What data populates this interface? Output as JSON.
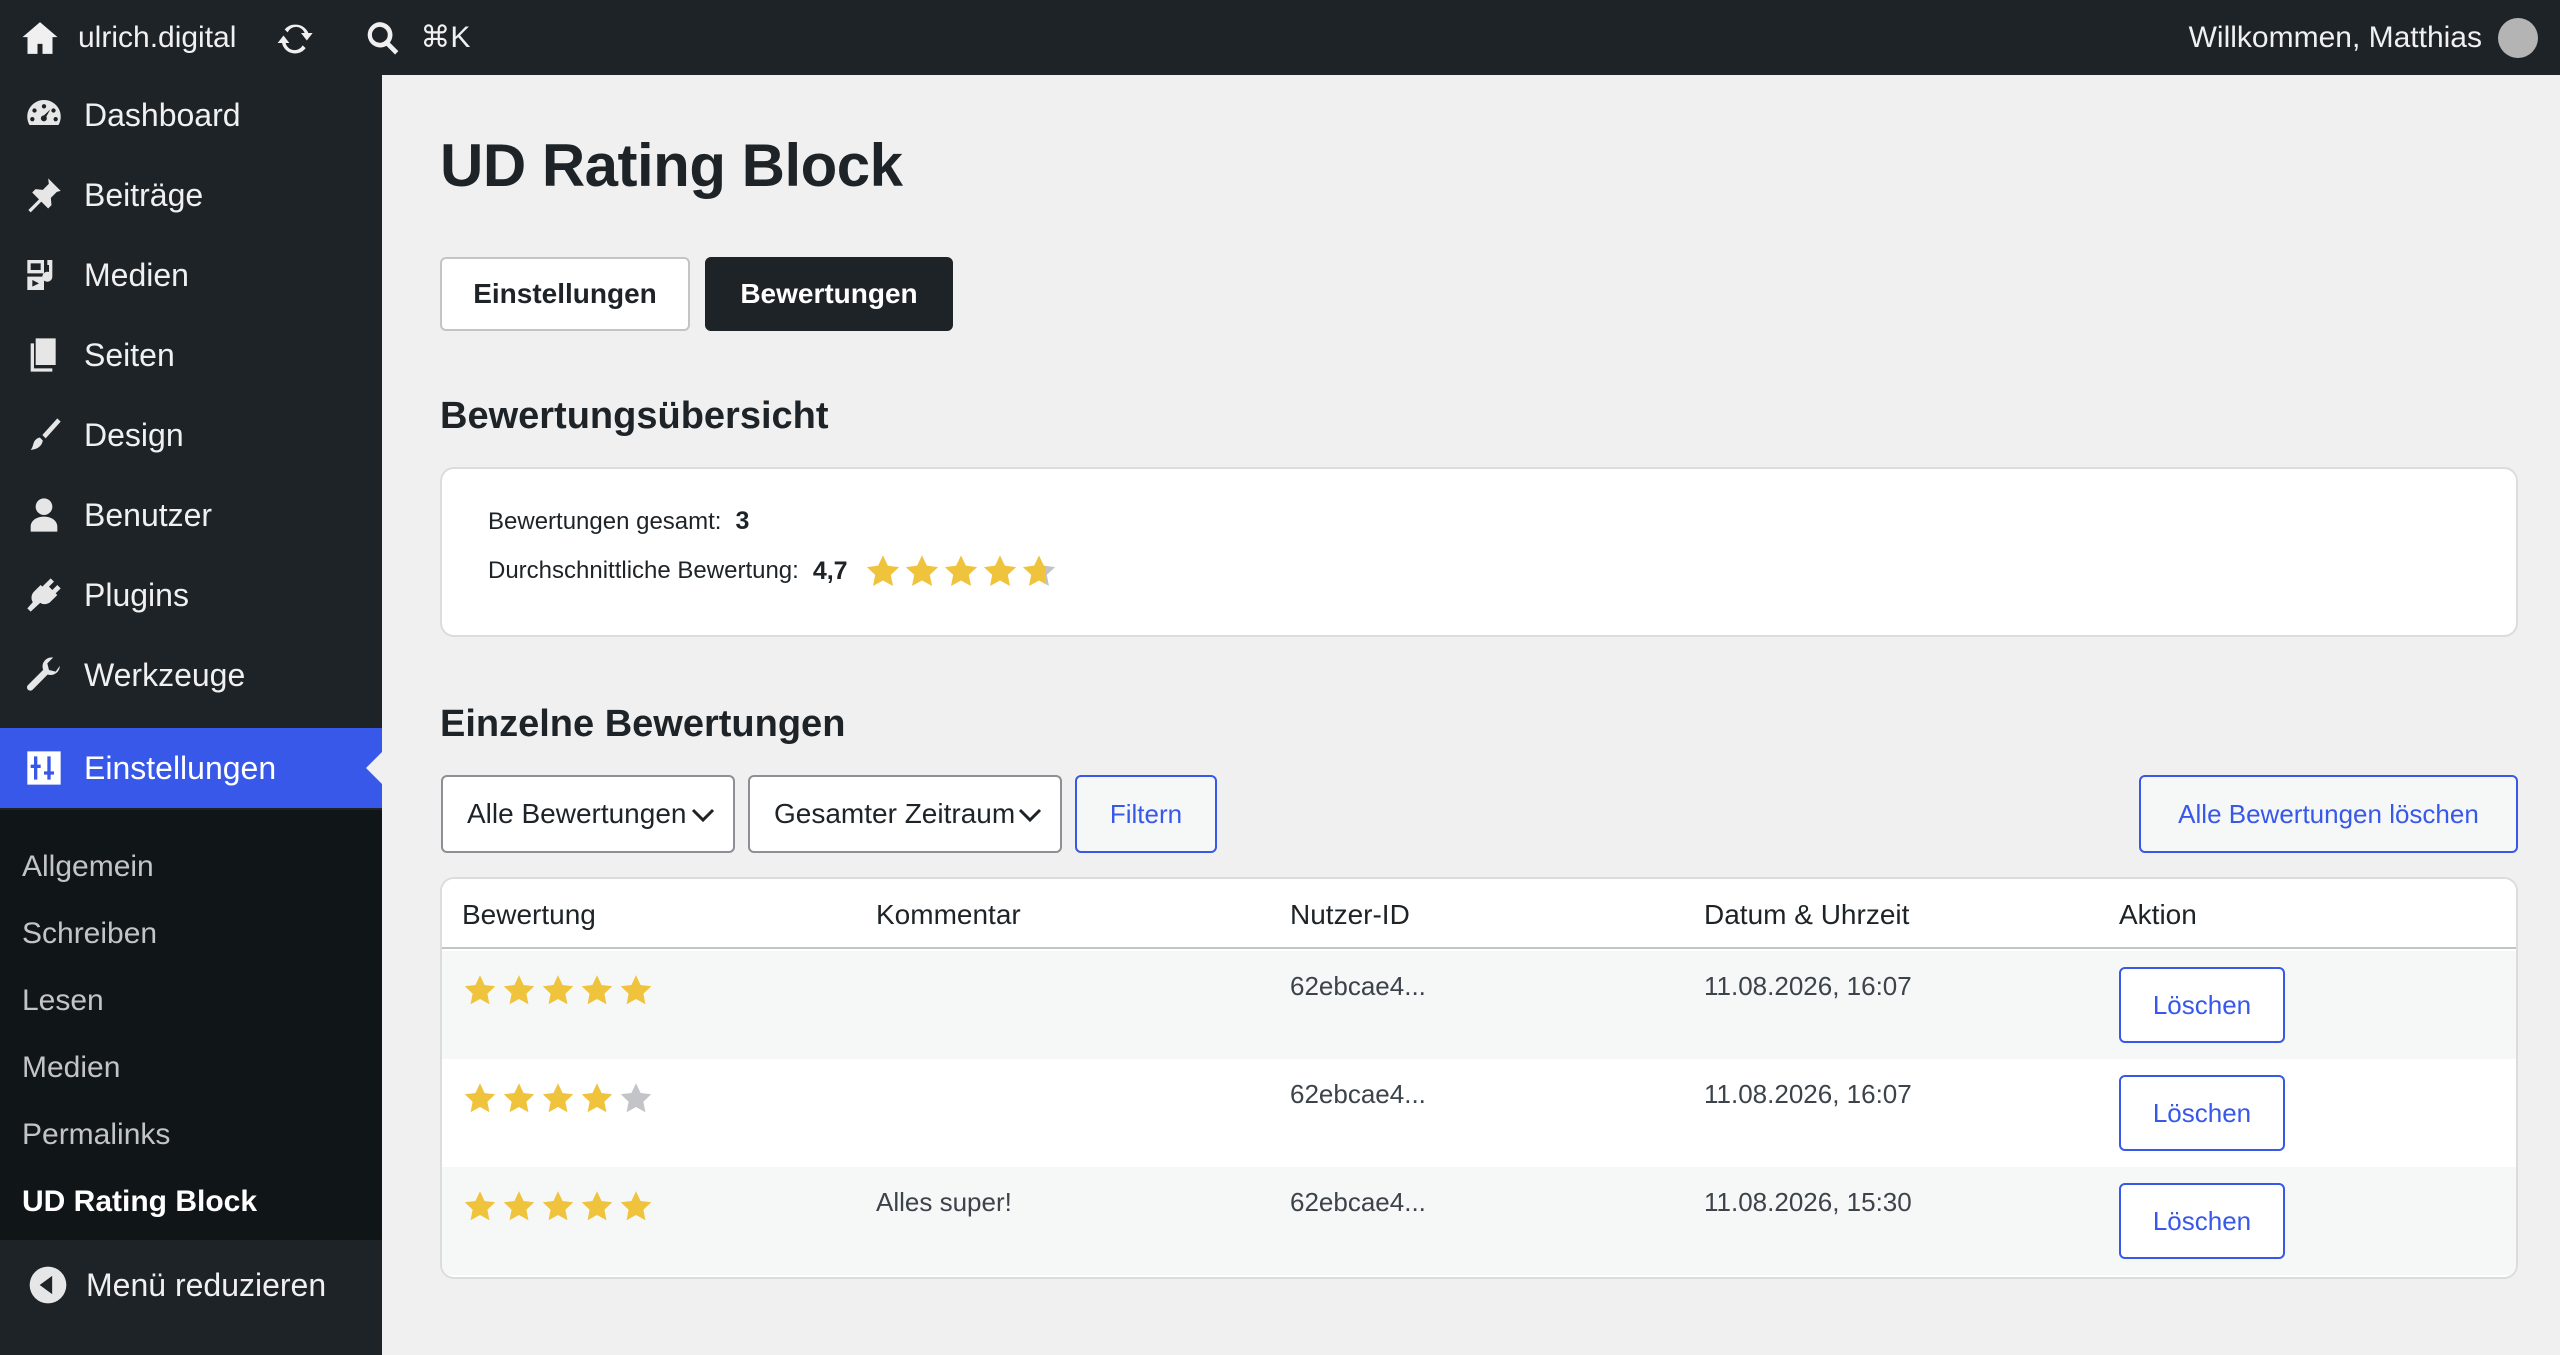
{
  "adminbar": {
    "site_name": "ulrich.digital",
    "search_shortcut": "⌘K",
    "welcome": "Willkommen, Matthias"
  },
  "sidebar": {
    "items": [
      {
        "label": "Dashboard",
        "icon": "dashboard-icon"
      },
      {
        "label": "Beiträge",
        "icon": "pin-icon"
      },
      {
        "label": "Medien",
        "icon": "media-icon"
      },
      {
        "label": "Seiten",
        "icon": "pages-icon"
      },
      {
        "label": "Design",
        "icon": "brush-icon"
      },
      {
        "label": "Benutzer",
        "icon": "user-icon"
      },
      {
        "label": "Plugins",
        "icon": "plug-icon"
      },
      {
        "label": "Werkzeuge",
        "icon": "wrench-icon"
      },
      {
        "label": "Einstellungen",
        "icon": "settings-icon",
        "active": true
      }
    ],
    "submenu": [
      "Allgemein",
      "Schreiben",
      "Lesen",
      "Medien",
      "Permalinks",
      "UD Rating Block"
    ],
    "submenu_current": "UD Rating Block",
    "collapse_label": "Menü reduzieren"
  },
  "main": {
    "title": "UD Rating Block",
    "tabs": [
      {
        "label": "Einstellungen",
        "active": false
      },
      {
        "label": "Bewertungen",
        "active": true
      }
    ],
    "overview": {
      "heading": "Bewertungsübersicht",
      "total_label": "Bewertungen gesamt:",
      "total_value": "3",
      "avg_label": "Durchschnittliche Bewertung:",
      "avg_value": "4,7",
      "avg_rating": 4.7
    },
    "ratings": {
      "heading": "Einzelne Bewertungen",
      "filter_rating": "Alle Bewertungen",
      "filter_period": "Gesamter Zeitraum",
      "filter_button": "Filtern",
      "delete_all_button": "Alle Bewertungen löschen",
      "columns": [
        "Bewertung",
        "Kommentar",
        "Nutzer-ID",
        "Datum & Uhrzeit",
        "Aktion"
      ],
      "rows": [
        {
          "stars": 5,
          "comment": "",
          "user_id": "62ebcae4...",
          "datetime": "11.08.2026, 16:07",
          "action": "Löschen"
        },
        {
          "stars": 4,
          "comment": "",
          "user_id": "62ebcae4...",
          "datetime": "11.08.2026, 16:07",
          "action": "Löschen"
        },
        {
          "stars": 5,
          "comment": "Alles super!",
          "user_id": "62ebcae4...",
          "datetime": "11.08.2026, 15:30",
          "action": "Löschen"
        }
      ]
    }
  },
  "colors": {
    "accent": "#3858e9",
    "star": "#f0c33c",
    "star_empty": "#c3c4c7",
    "dark": "#1d2327"
  }
}
